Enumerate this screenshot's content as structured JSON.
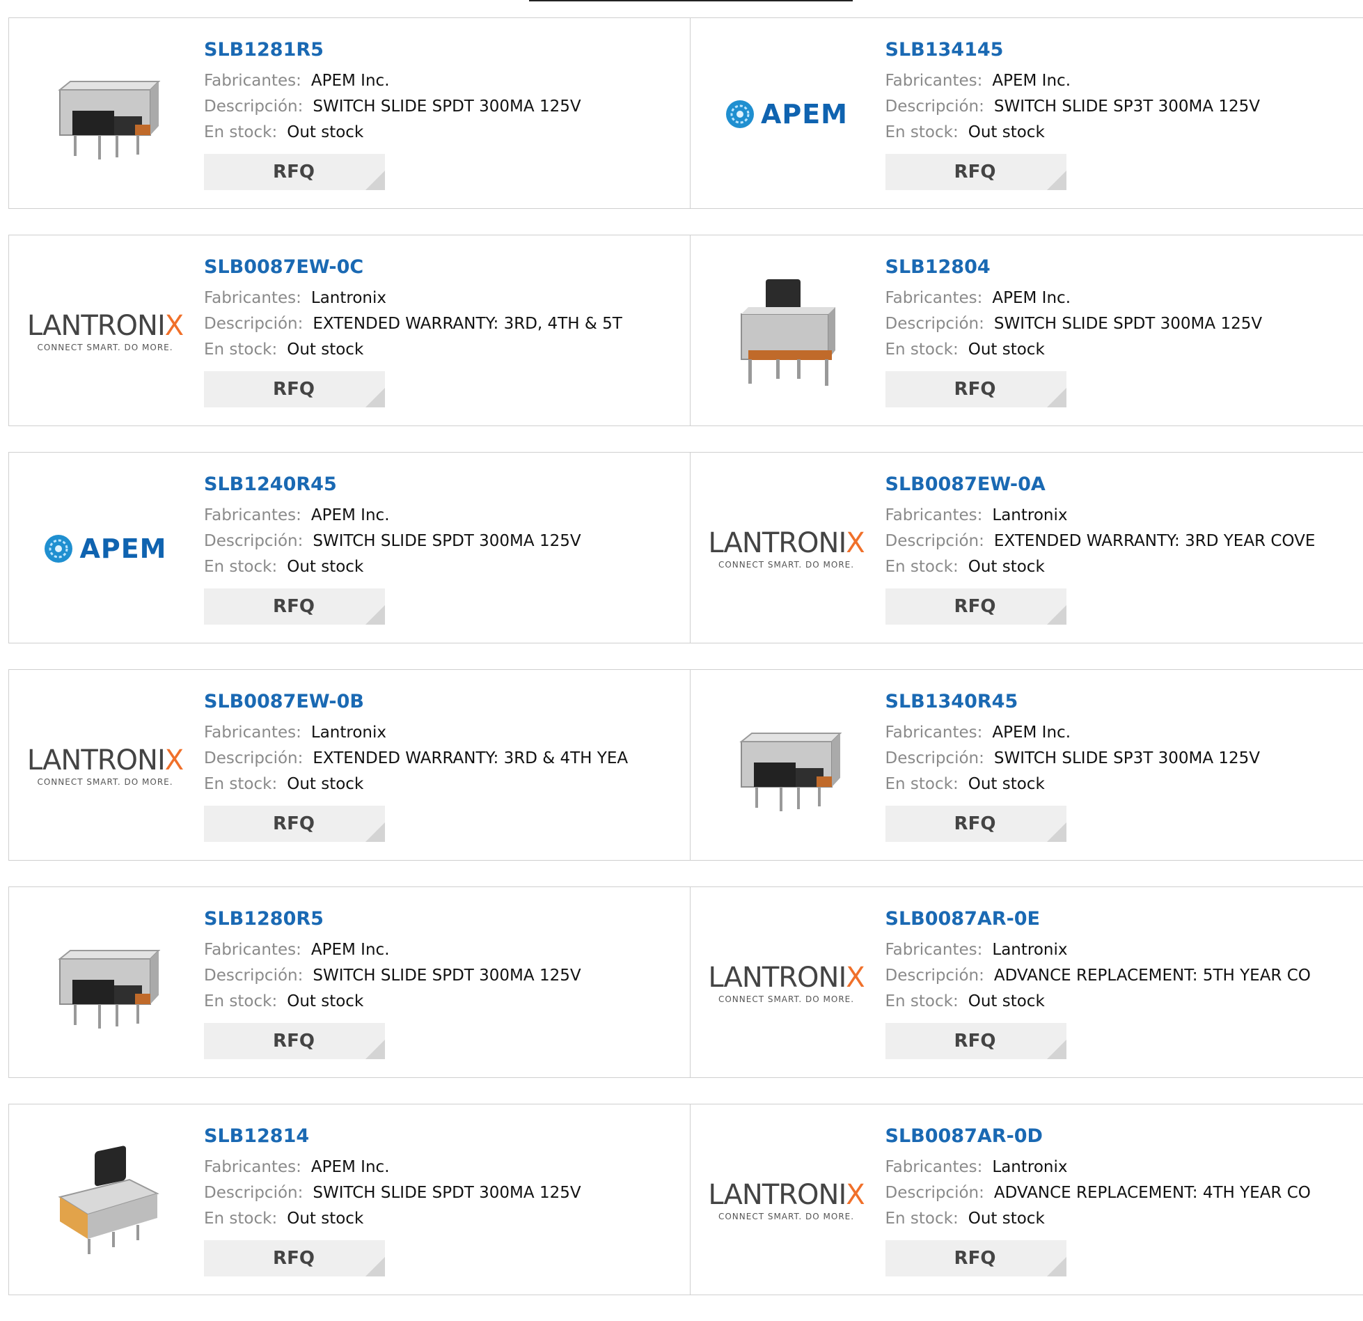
{
  "labels": {
    "manufacturer": "Fabricantes:",
    "description": "Descripción:",
    "stock": "En stock:",
    "rfq": "RFQ"
  },
  "products": [
    {
      "pn": "SLB1281R5",
      "mfr": "APEM Inc.",
      "desc": "SWITCH SLIDE SPDT 300MA 125V",
      "stock": "Out stock",
      "image": "switch-side"
    },
    {
      "pn": "SLB134145",
      "mfr": "APEM Inc.",
      "desc": "SWITCH SLIDE SP3T 300MA 125V",
      "stock": "Out stock",
      "image": "apem-logo"
    },
    {
      "pn": "SLB0087EW-0C",
      "mfr": "Lantronix",
      "desc": "EXTENDED WARRANTY: 3RD, 4TH & 5T",
      "stock": "Out stock",
      "image": "lantronix-logo"
    },
    {
      "pn": "SLB12804",
      "mfr": "APEM Inc.",
      "desc": "SWITCH SLIDE SPDT 300MA 125V",
      "stock": "Out stock",
      "image": "switch-upright"
    },
    {
      "pn": "SLB1240R45",
      "mfr": "APEM Inc.",
      "desc": "SWITCH SLIDE SPDT 300MA 125V",
      "stock": "Out stock",
      "image": "apem-logo"
    },
    {
      "pn": "SLB0087EW-0A",
      "mfr": "Lantronix",
      "desc": "EXTENDED WARRANTY: 3RD YEAR COVE",
      "stock": "Out stock",
      "image": "lantronix-logo"
    },
    {
      "pn": "SLB0087EW-0B",
      "mfr": "Lantronix",
      "desc": "EXTENDED WARRANTY: 3RD & 4TH YEA",
      "stock": "Out stock",
      "image": "lantronix-logo"
    },
    {
      "pn": "SLB1340R45",
      "mfr": "APEM Inc.",
      "desc": "SWITCH SLIDE SP3T 300MA 125V",
      "stock": "Out stock",
      "image": "switch-side"
    },
    {
      "pn": "SLB1280R5",
      "mfr": "APEM Inc.",
      "desc": "SWITCH SLIDE SPDT 300MA 125V",
      "stock": "Out stock",
      "image": "switch-side"
    },
    {
      "pn": "SLB0087AR-0E",
      "mfr": "Lantronix",
      "desc": "ADVANCE REPLACEMENT: 5TH YEAR CO",
      "stock": "Out stock",
      "image": "lantronix-logo"
    },
    {
      "pn": "SLB12814",
      "mfr": "APEM Inc.",
      "desc": "SWITCH SLIDE SPDT 300MA 125V",
      "stock": "Out stock",
      "image": "switch-angled"
    },
    {
      "pn": "SLB0087AR-0D",
      "mfr": "Lantronix",
      "desc": "ADVANCE REPLACEMENT: 4TH YEAR CO",
      "stock": "Out stock",
      "image": "lantronix-logo"
    }
  ],
  "logos": {
    "apem": "APEM",
    "lantronix_main": "LANTRONIX",
    "lantronix_tag": "CONNECT SMART. DO MORE."
  },
  "colors": {
    "link": "#1a69b3",
    "label": "#8a8a8a",
    "border": "#cfcfcf",
    "button_bg": "#efefef",
    "lantronix_x": "#f0702a"
  }
}
